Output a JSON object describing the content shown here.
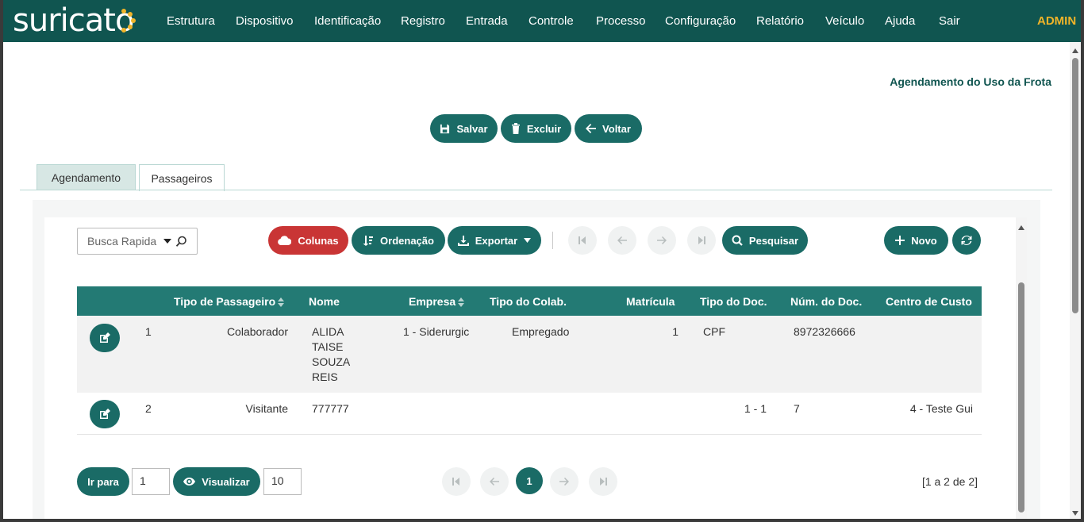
{
  "app": {
    "logo_text": "suricato",
    "nav": [
      "Estrutura",
      "Dispositivo",
      "Identificação",
      "Registro",
      "Entrada",
      "Controle",
      "Processo",
      "Configuração",
      "Relatório",
      "Veículo",
      "Ajuda",
      "Sair"
    ],
    "user": "ADMIN"
  },
  "page": {
    "title": "Agendamento do Uso da Frota"
  },
  "actions": {
    "save": "Salvar",
    "delete": "Excluir",
    "back": "Voltar"
  },
  "tabs": [
    {
      "label": "Agendamento",
      "active": false
    },
    {
      "label": "Passageiros",
      "active": true
    }
  ],
  "toolbar": {
    "search_placeholder": "Busca Rapida",
    "columns": "Colunas",
    "ordering": "Ordenação",
    "export": "Exportar",
    "search": "Pesquisar",
    "new": "Novo"
  },
  "table": {
    "headers": [
      "Tipo de Passageiro",
      "Nome",
      "Empresa",
      "Tipo do Colab.",
      "Matrícula",
      "Tipo do Doc.",
      "Núm. do Doc.",
      "Centro de Custo"
    ],
    "rows": [
      {
        "num": "1",
        "tipo": "Colaborador",
        "nome": [
          "ALIDA",
          "TAISE",
          "SOUZA",
          "REIS"
        ],
        "empresa": "1 - Siderurgic",
        "tipo_colab": "Empregado",
        "matricula": "1",
        "tipo_doc": "CPF",
        "num_doc": "8972326666",
        "centro": ""
      },
      {
        "num": "2",
        "tipo": "Visitante",
        "nome": [
          "777777"
        ],
        "empresa": "",
        "tipo_colab": "",
        "matricula": "",
        "tipo_doc": "1 - 1",
        "num_doc": "7",
        "centro": "4 - Teste Gui"
      }
    ]
  },
  "footer": {
    "goto": "Ir para",
    "goto_value": "1",
    "view": "Visualizar",
    "view_value": "10",
    "current_page": "1",
    "count": "[1 a 2 de 2]"
  },
  "colors": {
    "nav": "#105550",
    "primary": "#1a6b66",
    "danger": "#c93535",
    "accent": "#f0b429"
  }
}
